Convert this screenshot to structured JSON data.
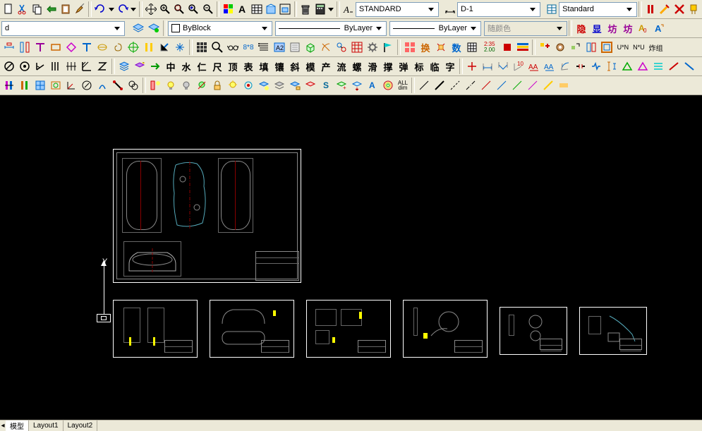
{
  "row1": {
    "style_text": "STANDARD",
    "dim_text": "D-1",
    "std2": "Standard"
  },
  "row2": {
    "layer_d": "d",
    "color": "ByBlock",
    "linetype": "ByLayer",
    "lineweight": "ByLayer",
    "plotstyle": "随颜色"
  },
  "row3_cjk": [
    "中",
    "水",
    "仁",
    "尺",
    "顶",
    "表",
    "填",
    "镶",
    "斜",
    "模",
    "产",
    "流",
    "螺",
    "滑",
    "撑",
    "弹",
    "标",
    "临",
    "字"
  ],
  "row2_right": [
    "隐",
    "显",
    "坊",
    "坊"
  ],
  "row3_right": [
    "换",
    "数"
  ],
  "row3_far": [
    "U*N",
    "N*U",
    "炸组"
  ],
  "row3_time": "2:35",
  "row3_num": "2.00",
  "tabs": {
    "model": "模型",
    "l1": "Layout1",
    "l2": "Layout2"
  },
  "ucs_y": "Y",
  "dim_all": "ALL\ndim"
}
